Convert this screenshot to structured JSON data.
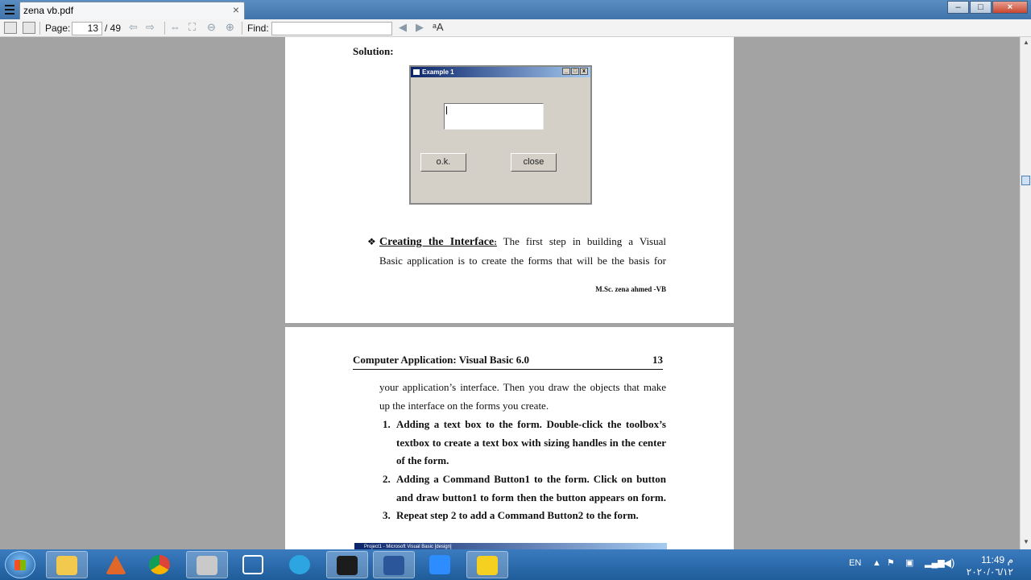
{
  "window": {
    "tab_title": "zena vb.pdf",
    "tab_close": "×",
    "controls": {
      "minimize": "–",
      "maximize": "□",
      "close": "×"
    }
  },
  "toolbar": {
    "page_label": "Page:",
    "page_value": "13",
    "page_total": "/ 49",
    "find_label": "Find:",
    "find_value": ""
  },
  "document": {
    "page1": {
      "solution_label": "Solution:",
      "vb_form": {
        "title": "Example 1",
        "ok_button": "o.k.",
        "close_button": "close"
      },
      "bullet_symbol": "❖",
      "bullet_heading": "Creating the Interface",
      "bullet_heading_suffix": ":",
      "bullet_line1_rest": " The first step in building a Visual",
      "bullet_line2": "Basic application is to create the forms that will be the basis for",
      "footer": "M.Sc. zena ahmed -VB"
    },
    "page2": {
      "header_title": "Computer Application: Visual Basic 6.0",
      "header_page": "13",
      "line1": "your application’s interface. Then you draw the objects that make",
      "line2": "up the interface on the forms you create.",
      "items": [
        {
          "num": "1.",
          "lines": [
            "Adding a text box to the form. Double-click the toolbox’s",
            "textbox to create a text box with sizing handles in the center",
            "of the form."
          ]
        },
        {
          "num": "2.",
          "lines": [
            "Adding a Command Button1 to the form. Click on button",
            "and draw button1 to form then the button appears on form."
          ]
        },
        {
          "num": "3.",
          "lines": [
            "Repeat step 2 to add a Command Button2 to the form."
          ]
        }
      ],
      "figure_strip_text": "Project1 - Microsoft Visual Basic [design]"
    }
  },
  "taskbar": {
    "apps": [
      "file-explorer",
      "matlab",
      "chrome",
      "app-32",
      "screenshot-tool",
      "telegram",
      "filmora",
      "word",
      "zoom",
      "pdf-viewer"
    ],
    "tray": {
      "language": "EN",
      "time": "11:49 م",
      "date": "٢٠٢٠/٠٦/١٢"
    }
  },
  "colors": {
    "taskbar": "#1f5c9a",
    "title_gradient_start": "#0a246a",
    "viewer_background": "#a3a3a3"
  }
}
